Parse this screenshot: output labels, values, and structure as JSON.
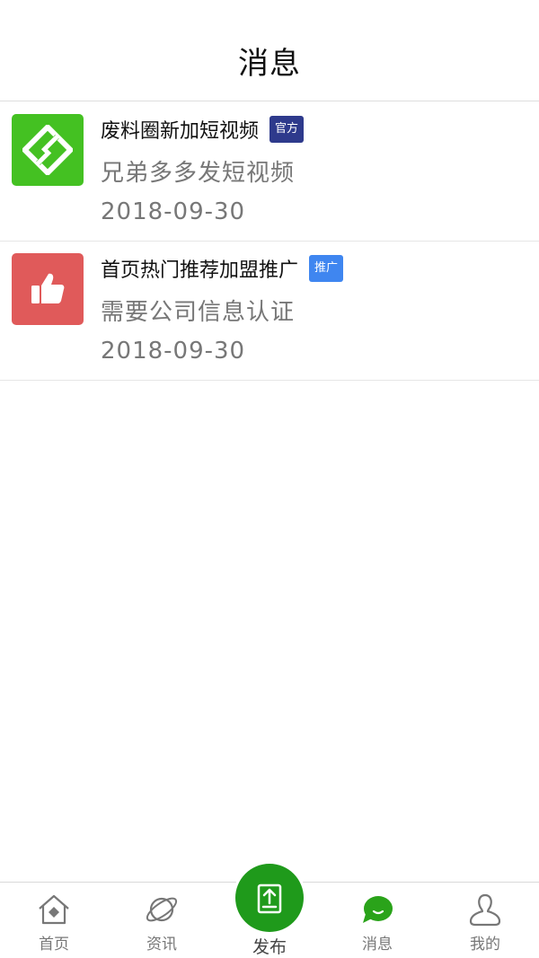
{
  "header": {
    "title": "消息"
  },
  "messages": [
    {
      "title": "废料圈新加短视频",
      "badge": "官方",
      "body": "兄弟多多发短视频",
      "date": "2018-09-30",
      "icon": "brand-logo-icon",
      "icon_color": "#44c122",
      "badge_color": "#2e3a8c"
    },
    {
      "title": "首页热门推荐加盟推广",
      "badge": "推广",
      "body": "需要公司信息认证",
      "date": "2018-09-30",
      "icon": "thumbs-up-icon",
      "icon_color": "#e05a5a",
      "badge_color": "#3f86f0"
    }
  ],
  "tabbar": {
    "home": "首页",
    "news": "资讯",
    "publish": "发布",
    "messages": "消息",
    "mine": "我的",
    "active": "messages",
    "active_color": "#2aa31a"
  }
}
